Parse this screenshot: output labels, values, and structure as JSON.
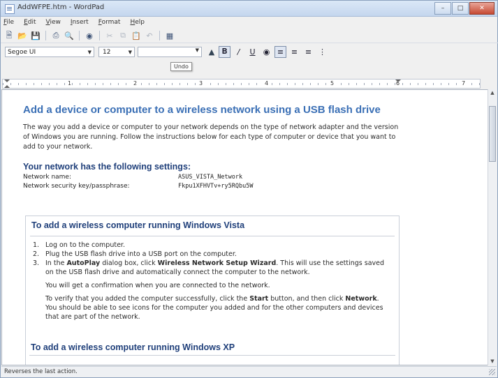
{
  "window": {
    "title": "AddWFPE.htm - WordPad"
  },
  "menu": [
    "File",
    "Edit",
    "View",
    "Insert",
    "Format",
    "Help"
  ],
  "toolbar": [
    "new-icon",
    "open-icon",
    "save-icon",
    "print-icon",
    "print-preview-icon",
    "find-icon",
    "cut-icon",
    "copy-icon",
    "paste-icon",
    "undo-icon",
    "insert-object-icon"
  ],
  "format": {
    "font": "Segoe UI",
    "size": "12",
    "tooltip": "Undo",
    "buttons": [
      "B",
      "I",
      "U",
      "color",
      "align-left",
      "center",
      "align-right",
      "bullets"
    ]
  },
  "ruler": {
    "numbers": [
      "1",
      "2",
      "3",
      "4",
      "5",
      "6",
      "7"
    ]
  },
  "doc": {
    "title": "Add a device or computer to a wireless network using a USB flash drive",
    "intro": "The way you add a device or computer to your network depends on the type of network adapter and the version of Windows you are running. Follow the instructions below for each type of computer or device that you want to add to your network.",
    "settings_heading": "Your network has the following settings:",
    "settings": [
      {
        "label": "Network name:",
        "value": "ASUS_VISTA_Network"
      },
      {
        "label": "Network security key/passphrase:",
        "value": "Fkpu1XFHVTv+ry5RQbu5W"
      }
    ],
    "vista": {
      "heading": "To add a wireless computer running Windows Vista",
      "steps": [
        {
          "num": "1.",
          "text": "Log on to the computer."
        },
        {
          "num": "2.",
          "text": "Plug the USB flash drive into a USB port on the computer."
        },
        {
          "num": "3.",
          "pre": "In the ",
          "b1": "AutoPlay",
          "mid": " dialog box, click ",
          "b2": "Wireless Network Setup Wizard",
          "post": ". This will use the settings saved on the USB flash drive and automatically connect the computer to the network."
        }
      ],
      "note1": "You will get a confirmation when you are connected to the network.",
      "note2_pre": "To verify that you added the computer successfully, click the ",
      "note2_b1": "Start",
      "note2_mid": " button, and then click ",
      "note2_b2": "Network",
      "note2_post": ". You should be able to see icons for the computer you added and for the other computers and devices that are part of the network."
    },
    "xp": {
      "heading": "To add a wireless computer running Windows XP"
    }
  },
  "status": "Reverses the last action."
}
